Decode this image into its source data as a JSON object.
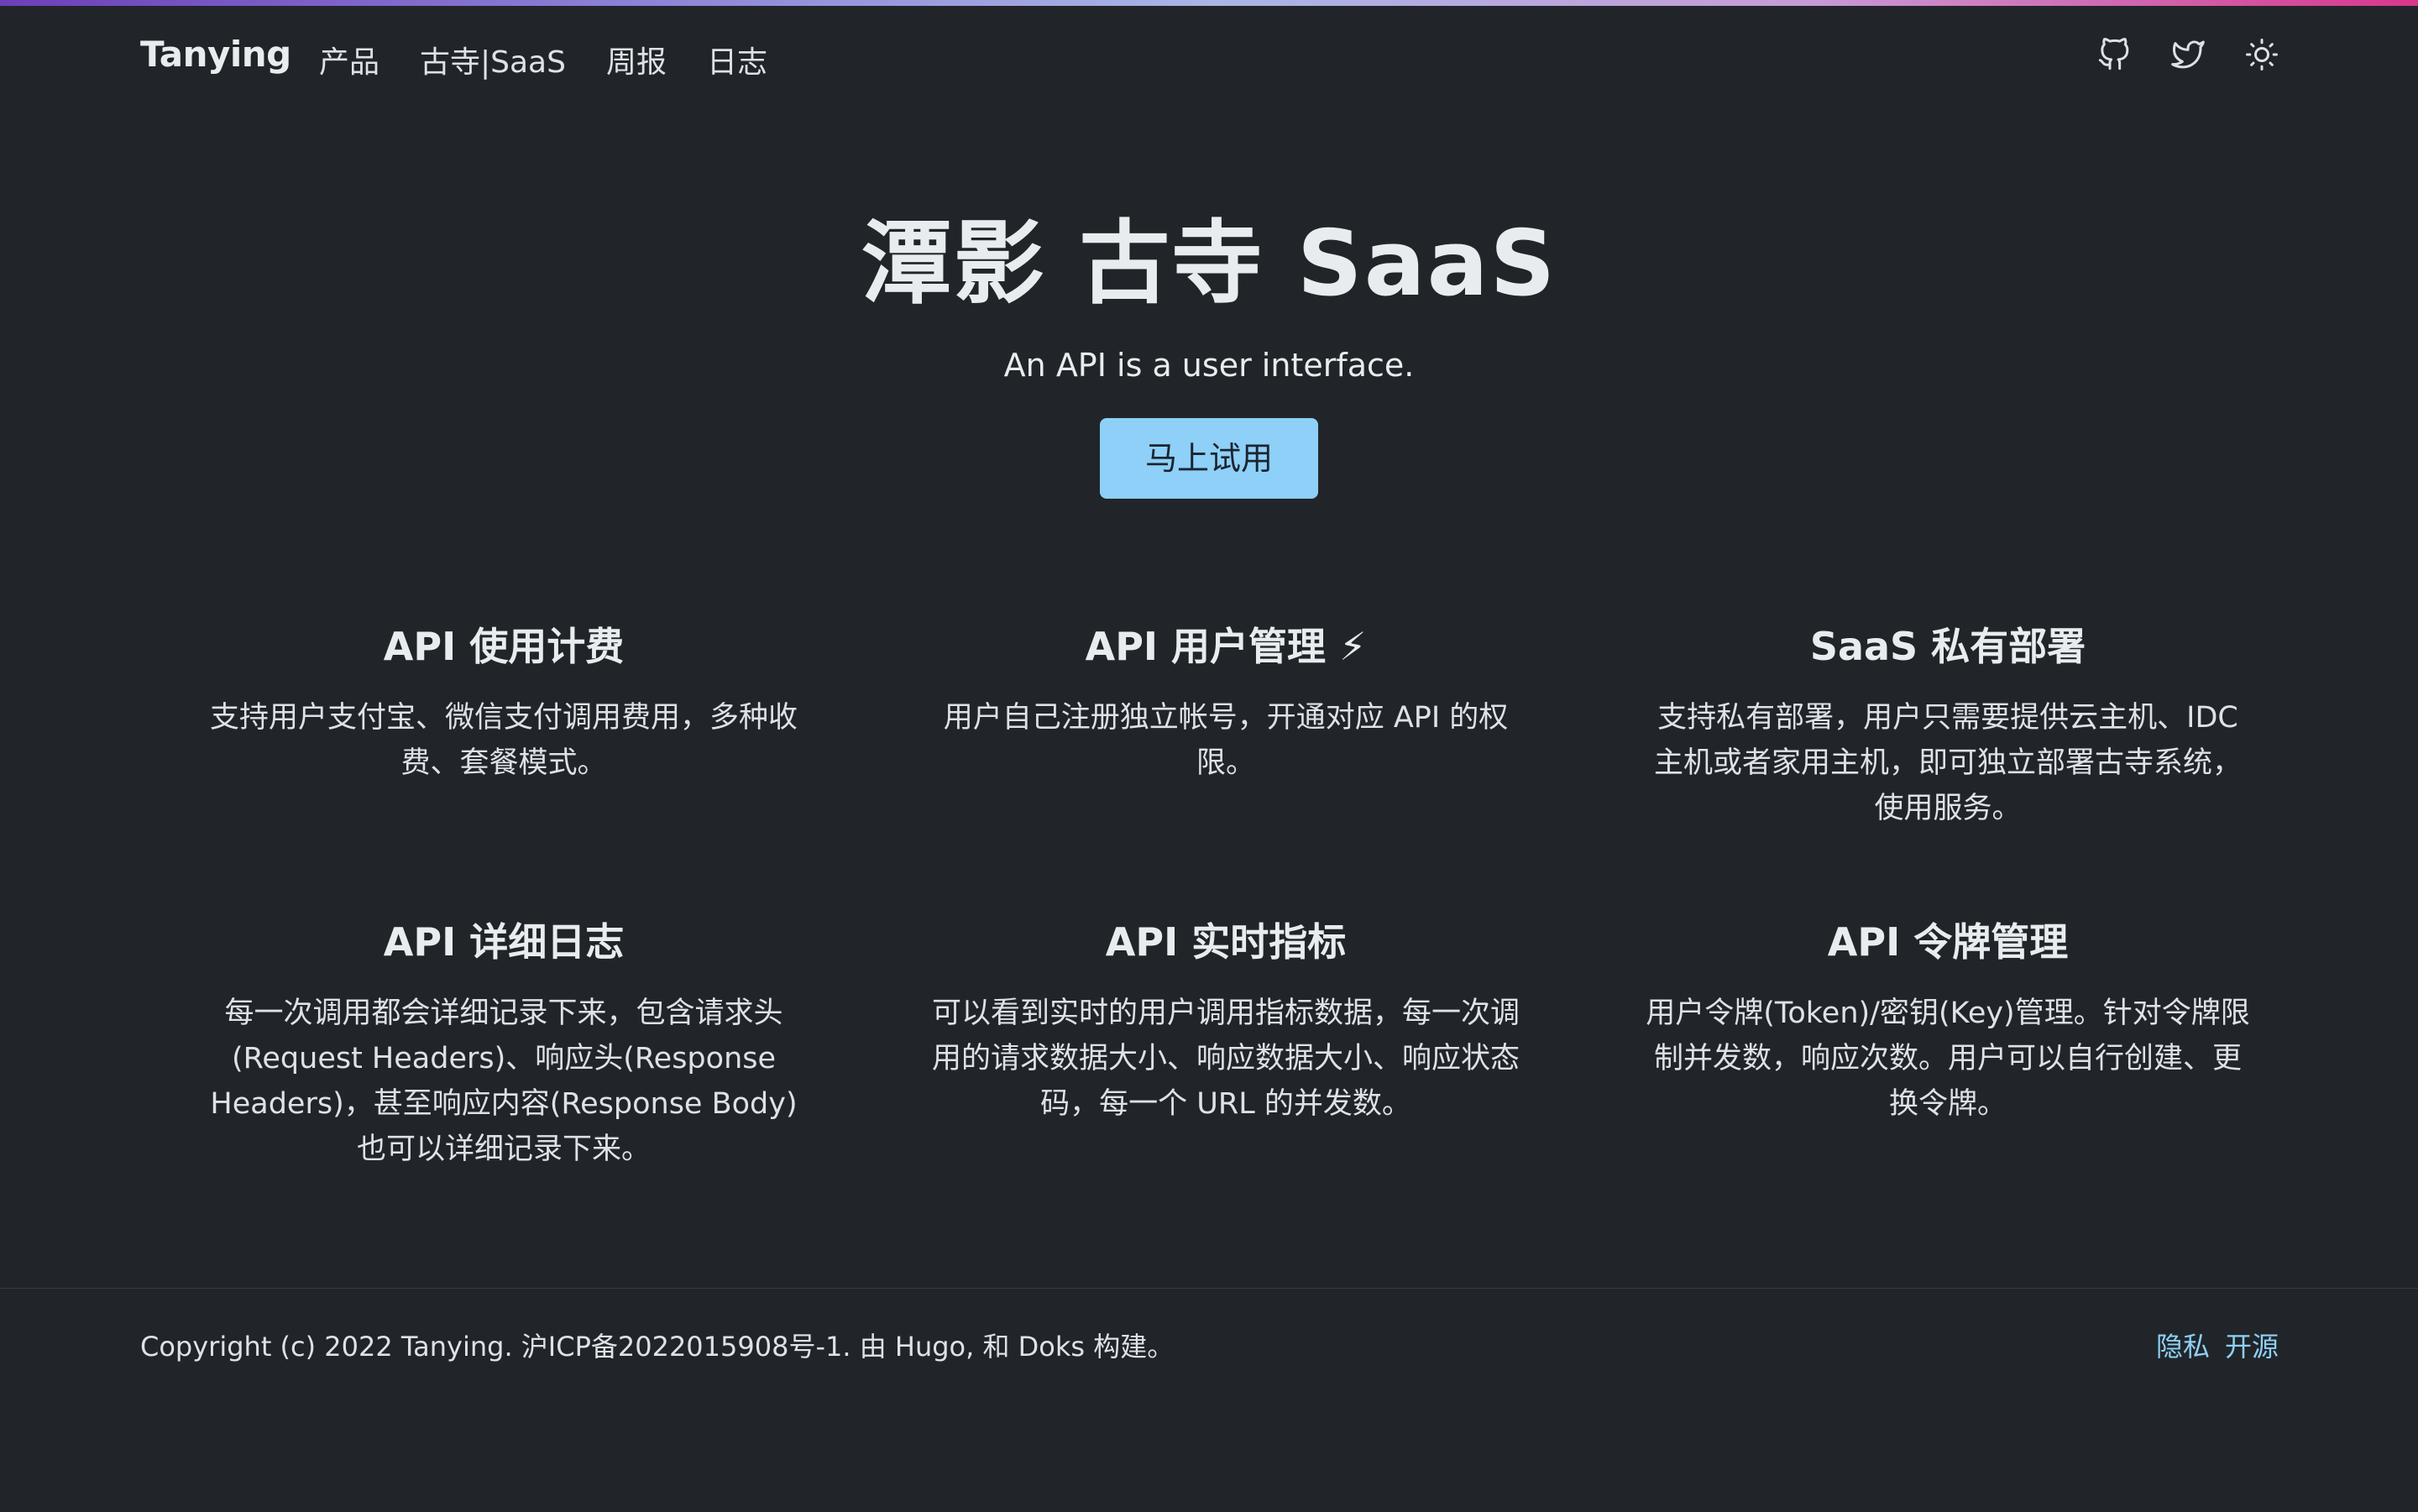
{
  "colors": {
    "background": "#212529",
    "accent": "#8ed0f7",
    "text": "#dee2e6"
  },
  "navbar": {
    "brand": "Tanying",
    "links": [
      "产品",
      "古寺|SaaS",
      "周报",
      "日志"
    ],
    "icons": [
      "github-icon",
      "twitter-icon",
      "theme-toggle-sun-icon"
    ]
  },
  "hero": {
    "title": "潭影 古寺 SaaS",
    "lead": "An API is a user interface.",
    "cta_label": "马上试用"
  },
  "features": [
    {
      "title": "API 使用计费",
      "text": "支持用户支付宝、微信支付调用费用，多种收费、套餐模式。"
    },
    {
      "title": "API 用户管理 ⚡",
      "text": "用户自己注册独立帐号，开通对应 API 的权限。"
    },
    {
      "title": "SaaS 私有部署",
      "text": "支持私有部署，用户只需要提供云主机、IDC主机或者家用主机，即可独立部署古寺系统，使用服务。"
    },
    {
      "title": "API 详细日志",
      "text": "每一次调用都会详细记录下来，包含请求头(Request Headers)、响应头(Response Headers)，甚至响应内容(Response Body)也可以详细记录下来。"
    },
    {
      "title": "API 实时指标",
      "text": "可以看到实时的用户调用指标数据，每一次调用的请求数据大小、响应数据大小、响应状态码，每一个 URL 的并发数。"
    },
    {
      "title": "API 令牌管理",
      "text": "用户令牌(Token)/密钥(Key)管理。针对令牌限制并发数，响应次数。用户可以自行创建、更换令牌。"
    }
  ],
  "footer": {
    "copyright": "Copyright (c) 2022 Tanying. 沪ICP备2022015908号-1. 由 Hugo, 和 Doks 构建。",
    "links": [
      "隐私",
      "开源"
    ]
  }
}
